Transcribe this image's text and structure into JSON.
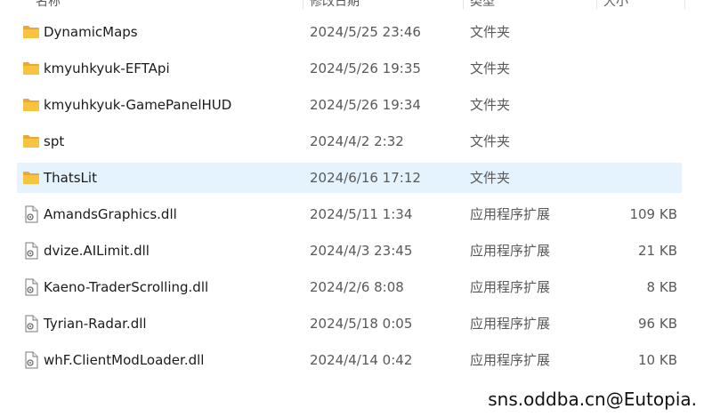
{
  "header": {
    "columns": [
      "名称",
      "修改日期",
      "类型",
      "大小"
    ]
  },
  "rows": [
    {
      "name": "DynamicMaps",
      "date": "2024/5/25 23:46",
      "type": "文件夹",
      "size": "",
      "icon": "folder-icon"
    },
    {
      "name": "kmyuhkyuk-EFTApi",
      "date": "2024/5/26 19:35",
      "type": "文件夹",
      "size": "",
      "icon": "folder-icon"
    },
    {
      "name": "kmyuhkyuk-GamePanelHUD",
      "date": "2024/5/26 19:34",
      "type": "文件夹",
      "size": "",
      "icon": "folder-icon"
    },
    {
      "name": "spt",
      "date": "2024/4/2 2:32",
      "type": "文件夹",
      "size": "",
      "icon": "folder-icon"
    },
    {
      "name": "ThatsLit",
      "date": "2024/6/16 17:12",
      "type": "文件夹",
      "size": "",
      "icon": "folder-icon",
      "selected": true
    },
    {
      "name": "AmandsGraphics.dll",
      "date": "2024/5/11 1:34",
      "type": "应用程序扩展",
      "size": "109 KB",
      "icon": "dll-file-icon"
    },
    {
      "name": "dvize.AILimit.dll",
      "date": "2024/4/3 23:45",
      "type": "应用程序扩展",
      "size": "21 KB",
      "icon": "dll-file-icon"
    },
    {
      "name": "Kaeno-TraderScrolling.dll",
      "date": "2024/2/6 8:08",
      "type": "应用程序扩展",
      "size": "8 KB",
      "icon": "dll-file-icon"
    },
    {
      "name": "Tyrian-Radar.dll",
      "date": "2024/5/18 0:05",
      "type": "应用程序扩展",
      "size": "96 KB",
      "icon": "dll-file-icon"
    },
    {
      "name": "whF.ClientModLoader.dll",
      "date": "2024/4/14 0:42",
      "type": "应用程序扩展",
      "size": "10 KB",
      "icon": "dll-file-icon"
    }
  ],
  "watermark": "sns.oddba.cn@Eutopia.",
  "colors": {
    "selected_row": "#e5f3ff",
    "folder_yellow": "#f8c440"
  }
}
